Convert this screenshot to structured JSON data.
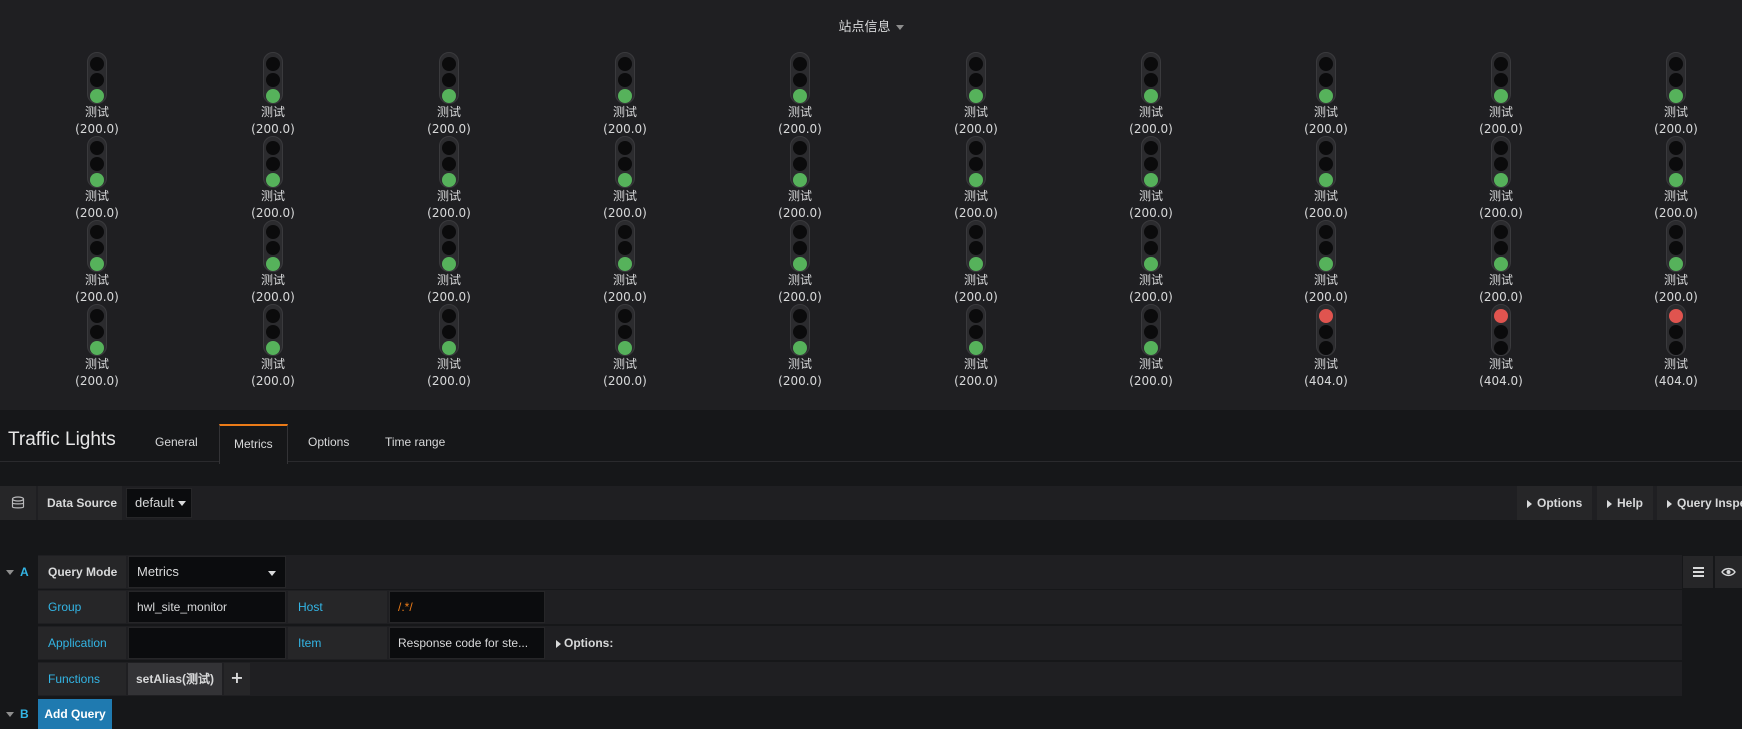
{
  "panel": {
    "title": "站点信息",
    "lights": [
      {
        "label": "测试",
        "value": "(200.0)",
        "state": "green"
      },
      {
        "label": "测试",
        "value": "(200.0)",
        "state": "green"
      },
      {
        "label": "测试",
        "value": "(200.0)",
        "state": "green"
      },
      {
        "label": "测试",
        "value": "(200.0)",
        "state": "green"
      },
      {
        "label": "测试",
        "value": "(200.0)",
        "state": "green"
      },
      {
        "label": "测试",
        "value": "(200.0)",
        "state": "green"
      },
      {
        "label": "测试",
        "value": "(200.0)",
        "state": "green"
      },
      {
        "label": "测试",
        "value": "(200.0)",
        "state": "green"
      },
      {
        "label": "测试",
        "value": "(200.0)",
        "state": "green"
      },
      {
        "label": "测试",
        "value": "(200.0)",
        "state": "green"
      },
      {
        "label": "测试",
        "value": "(200.0)",
        "state": "green"
      },
      {
        "label": "测试",
        "value": "(200.0)",
        "state": "green"
      },
      {
        "label": "测试",
        "value": "(200.0)",
        "state": "green"
      },
      {
        "label": "测试",
        "value": "(200.0)",
        "state": "green"
      },
      {
        "label": "测试",
        "value": "(200.0)",
        "state": "green"
      },
      {
        "label": "测试",
        "value": "(200.0)",
        "state": "green"
      },
      {
        "label": "测试",
        "value": "(200.0)",
        "state": "green"
      },
      {
        "label": "测试",
        "value": "(200.0)",
        "state": "green"
      },
      {
        "label": "测试",
        "value": "(200.0)",
        "state": "green"
      },
      {
        "label": "测试",
        "value": "(200.0)",
        "state": "green"
      },
      {
        "label": "测试",
        "value": "(200.0)",
        "state": "green"
      },
      {
        "label": "测试",
        "value": "(200.0)",
        "state": "green"
      },
      {
        "label": "测试",
        "value": "(200.0)",
        "state": "green"
      },
      {
        "label": "测试",
        "value": "(200.0)",
        "state": "green"
      },
      {
        "label": "测试",
        "value": "(200.0)",
        "state": "green"
      },
      {
        "label": "测试",
        "value": "(200.0)",
        "state": "green"
      },
      {
        "label": "测试",
        "value": "(200.0)",
        "state": "green"
      },
      {
        "label": "测试",
        "value": "(200.0)",
        "state": "green"
      },
      {
        "label": "测试",
        "value": "(200.0)",
        "state": "green"
      },
      {
        "label": "测试",
        "value": "(200.0)",
        "state": "green"
      },
      {
        "label": "测试",
        "value": "(200.0)",
        "state": "green"
      },
      {
        "label": "测试",
        "value": "(200.0)",
        "state": "green"
      },
      {
        "label": "测试",
        "value": "(200.0)",
        "state": "green"
      },
      {
        "label": "测试",
        "value": "(200.0)",
        "state": "green"
      },
      {
        "label": "测试",
        "value": "(200.0)",
        "state": "green"
      },
      {
        "label": "测试",
        "value": "(200.0)",
        "state": "green"
      },
      {
        "label": "测试",
        "value": "(200.0)",
        "state": "green"
      },
      {
        "label": "测试",
        "value": "(404.0)",
        "state": "red"
      },
      {
        "label": "测试",
        "value": "(404.0)",
        "state": "red"
      },
      {
        "label": "测试",
        "value": "(404.0)",
        "state": "red"
      }
    ]
  },
  "editor": {
    "title": "Traffic Lights",
    "tabs": [
      "General",
      "Metrics",
      "Options",
      "Time range"
    ],
    "active_tab": "Metrics"
  },
  "datasource": {
    "label": "Data Source",
    "value": "default",
    "buttons": [
      "Options",
      "Help",
      "Query Inspe"
    ]
  },
  "query_a": {
    "letter": "A",
    "query_mode_label": "Query Mode",
    "query_mode_value": "Metrics",
    "group_label": "Group",
    "group_value": "hwl_site_monitor",
    "host_label": "Host",
    "host_value": "/.*/",
    "application_label": "Application",
    "application_value": "",
    "item_label": "Item",
    "item_value": "Response code for ste...",
    "options_label": "Options:",
    "functions_label": "Functions",
    "function_tag": "setAlias(测试)",
    "plus": "+"
  },
  "query_b": {
    "letter": "B",
    "add_query": "Add Query"
  },
  "colors": {
    "green": "#56b25b",
    "red": "#e0544f",
    "accent": "#eb7b18",
    "link": "#33b5e5",
    "primary_button": "#1f7ab0"
  }
}
